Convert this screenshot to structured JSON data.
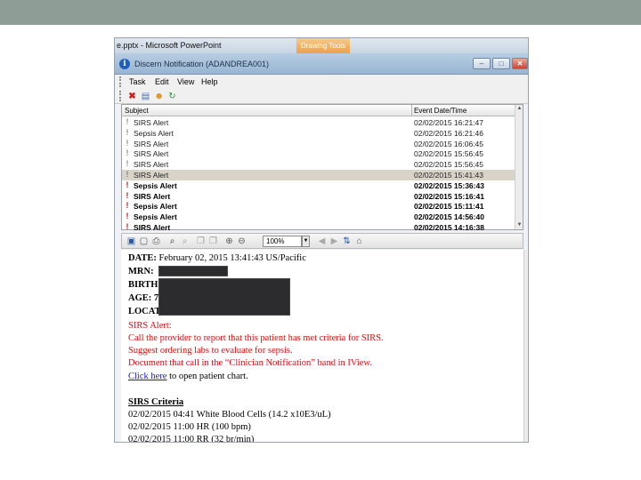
{
  "powerpoint": {
    "title": "e.pptx - Microsoft PowerPoint",
    "drawing_tools": "Drawing Tools"
  },
  "window": {
    "title": "Discern Notification (ADANDREA001)",
    "minimize": "–",
    "maximize": "□",
    "close": "✕"
  },
  "menu": [
    "Task",
    "Edit",
    "View",
    "Help"
  ],
  "list": {
    "columns": {
      "subject": "Subject",
      "date": "Event Date/Time"
    },
    "rows": [
      {
        "subject": "SIRS Alert",
        "date": "02/02/2015 16:21:47",
        "bold": false,
        "selected": false
      },
      {
        "subject": "Sepsis Alert",
        "date": "02/02/2015 16:21:46",
        "bold": false,
        "selected": false
      },
      {
        "subject": "SIRS Alert",
        "date": "02/02/2015 16:06:45",
        "bold": false,
        "selected": false
      },
      {
        "subject": "SIRS Alert",
        "date": "02/02/2015 15:56:45",
        "bold": false,
        "selected": false
      },
      {
        "subject": "SIRS Alert",
        "date": "02/02/2015 15:56:45",
        "bold": false,
        "selected": false
      },
      {
        "subject": "SIRS Alert",
        "date": "02/02/2015 15:41:43",
        "bold": false,
        "selected": true
      },
      {
        "subject": "Sepsis Alert",
        "date": "02/02/2015 15:36:43",
        "bold": true,
        "selected": false
      },
      {
        "subject": "SIRS Alert",
        "date": "02/02/2015 15:16:41",
        "bold": true,
        "selected": false
      },
      {
        "subject": "Sepsis Alert",
        "date": "02/02/2015 15:11:41",
        "bold": true,
        "selected": false
      },
      {
        "subject": "Sepsis Alert",
        "date": "02/02/2015 14:56:40",
        "bold": true,
        "selected": false
      },
      {
        "subject": "SIRS Alert",
        "date": "02/02/2015 14:16:38",
        "bold": true,
        "selected": false
      }
    ]
  },
  "viewer": {
    "zoom": "100%"
  },
  "document": {
    "date_label": "DATE:",
    "date_value": "February 02, 2015 13:41:43 US/Pacific",
    "mrn_label": "MRN:",
    "birth_label": "BIRTH",
    "age_label": "AGE: 7",
    "location_label": "LOCAT",
    "alert_title": "SIRS Alert:",
    "alert_lines": [
      "Call the provider to report that this patient has met criteria for SIRS.",
      "Suggest ordering labs to evaluate for sepsis.",
      "Document that call in the “Clinician Notification” band in IView."
    ],
    "link_text": "Click here",
    "link_suffix": " to open patient chart.",
    "criteria_title": "SIRS Criteria",
    "criteria": [
      "02/02/2015 04:41 White Blood Cells (14.2 x10E3/uL)",
      "02/02/2015 11:00 HR (100 bpm)",
      "02/02/2015 11:00 RR (32 br/min)"
    ]
  }
}
